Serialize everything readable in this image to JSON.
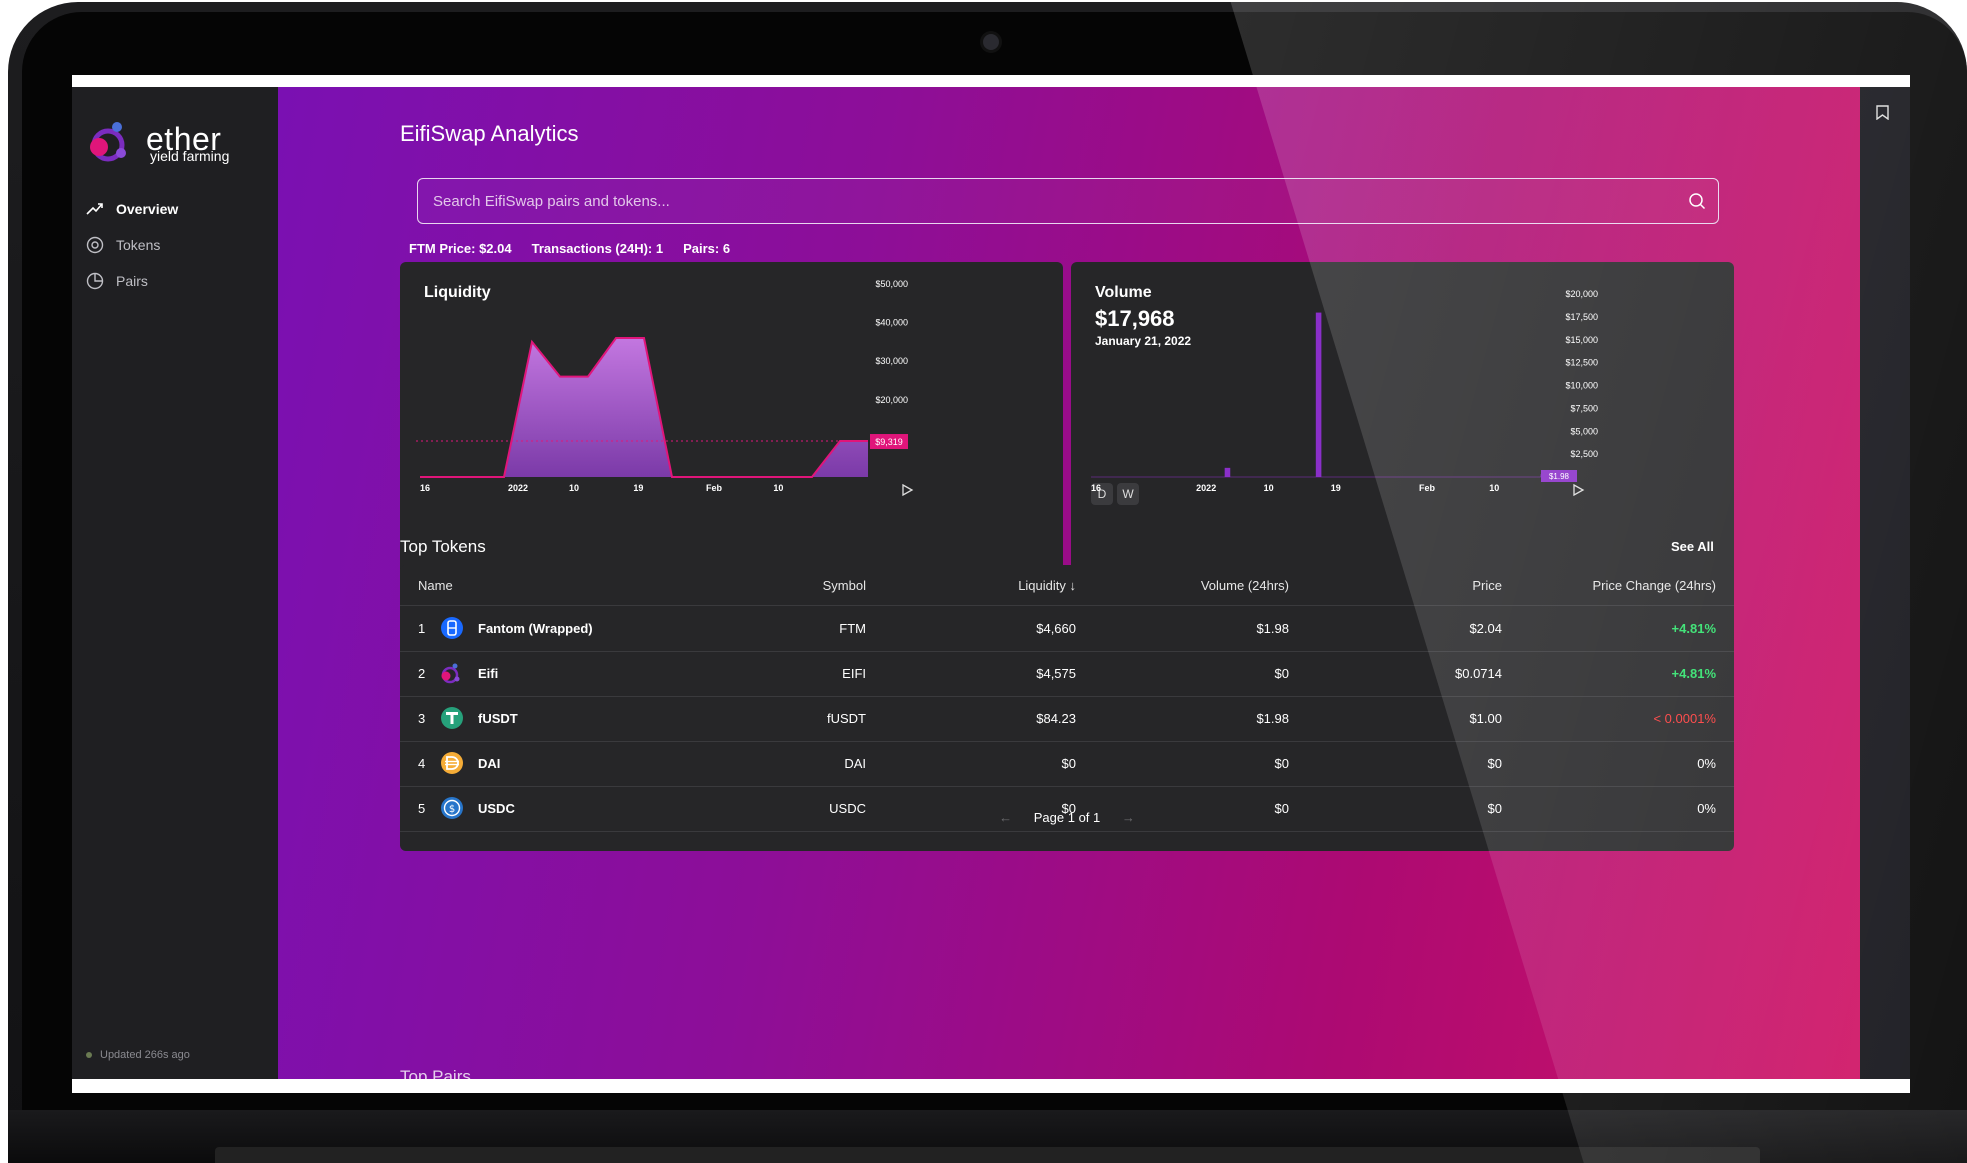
{
  "brand": {
    "name": "ether",
    "tagline": "yield farming"
  },
  "sidebar": {
    "items": [
      {
        "label": "Overview",
        "icon": "trend-icon",
        "active": true
      },
      {
        "label": "Tokens",
        "icon": "token-icon",
        "active": false
      },
      {
        "label": "Pairs",
        "icon": "pie-icon",
        "active": false
      }
    ],
    "updated": "Updated 266s ago"
  },
  "header": {
    "title": "EifiSwap Analytics",
    "search_placeholder": "Search EifiSwap pairs and tokens..."
  },
  "stats": {
    "ftm_price": "FTM Price: $2.04",
    "transactions": "Transactions (24H): 1",
    "pairs": "Pairs: 6"
  },
  "colors": {
    "accent": "#e0157a",
    "area_fill": "#b45bcc",
    "bar": "#8a2fc9",
    "positive": "#2fe06b",
    "negative": "#ff3b3b"
  },
  "chart_data": [
    {
      "type": "area",
      "title": "Liquidity",
      "x_ticks": [
        "16",
        "2022",
        "10",
        "19",
        "Feb",
        "10"
      ],
      "y_ticks": [
        "$50,000",
        "$40,000",
        "$30,000",
        "$20,000"
      ],
      "ylim": [
        0,
        50000
      ],
      "x": [
        0,
        1,
        2,
        3,
        4,
        5,
        6,
        7,
        8,
        9,
        10,
        11,
        12,
        13,
        14,
        15,
        16
      ],
      "values": [
        0,
        0,
        0,
        0,
        35000,
        26000,
        26000,
        36000,
        36000,
        0,
        0,
        0,
        0,
        0,
        0,
        9319,
        9319
      ],
      "current_label": "$9,319",
      "grid": false
    },
    {
      "type": "bar",
      "title": "Volume",
      "value": "$17,968",
      "date": "January 21, 2022",
      "x_ticks": [
        "16",
        "2022",
        "10",
        "19",
        "Feb",
        "10"
      ],
      "y_ticks": [
        "$20,000",
        "$17,500",
        "$15,000",
        "$12,500",
        "$10,000",
        "$7,500",
        "$5,000",
        "$2,500"
      ],
      "ylim": [
        0,
        20000
      ],
      "values": [
        0,
        0,
        0,
        0,
        0,
        0,
        0,
        0,
        0,
        0,
        0,
        0,
        0,
        0,
        0,
        0,
        0,
        0,
        0,
        0,
        0,
        0,
        1000,
        0,
        0,
        0,
        0,
        0,
        0,
        0,
        0,
        0,
        0,
        0,
        0,
        0,
        0,
        17968,
        0,
        0,
        0,
        0,
        0,
        0,
        0,
        0,
        0,
        0,
        0,
        0,
        0,
        0,
        0,
        0,
        0,
        0,
        0,
        0,
        0,
        0,
        0,
        0,
        0,
        0,
        0,
        0,
        0,
        0,
        0,
        0,
        0,
        0,
        0,
        0,
        300,
        300,
        0,
        0,
        0
      ],
      "current_label": "$1.98",
      "toggle": [
        "D",
        "W"
      ],
      "grid": false
    }
  ],
  "top_tokens": {
    "title": "Top Tokens",
    "see_all": "See All",
    "columns": [
      "Name",
      "Symbol",
      "Liquidity ↓",
      "Volume (24hrs)",
      "Price",
      "Price Change (24hrs)"
    ],
    "rows": [
      {
        "rank": "1",
        "name": "Fantom (Wrapped)",
        "icon": "fantom-icon",
        "symbol": "FTM",
        "liquidity": "$4,660",
        "volume": "$1.98",
        "price": "$2.04",
        "change": "+4.81%",
        "trend": "up"
      },
      {
        "rank": "2",
        "name": "Eifi",
        "icon": "eifi-icon",
        "symbol": "EIFI",
        "liquidity": "$4,575",
        "volume": "$0",
        "price": "$0.0714",
        "change": "+4.81%",
        "trend": "up"
      },
      {
        "rank": "3",
        "name": "fUSDT",
        "icon": "tether-icon",
        "symbol": "fUSDT",
        "liquidity": "$84.23",
        "volume": "$1.98",
        "price": "$1.00",
        "change": "< 0.0001%",
        "trend": "down"
      },
      {
        "rank": "4",
        "name": "DAI",
        "icon": "dai-icon",
        "symbol": "DAI",
        "liquidity": "$0",
        "volume": "$0",
        "price": "$0",
        "change": "0%",
        "trend": "flat"
      },
      {
        "rank": "5",
        "name": "USDC",
        "icon": "usdc-icon",
        "symbol": "USDC",
        "liquidity": "$0",
        "volume": "$0",
        "price": "$0",
        "change": "0%",
        "trend": "flat"
      }
    ],
    "pager": {
      "prev": "←",
      "label": "Page 1 of 1",
      "next": "→"
    }
  },
  "next_section": "Top Pairs"
}
